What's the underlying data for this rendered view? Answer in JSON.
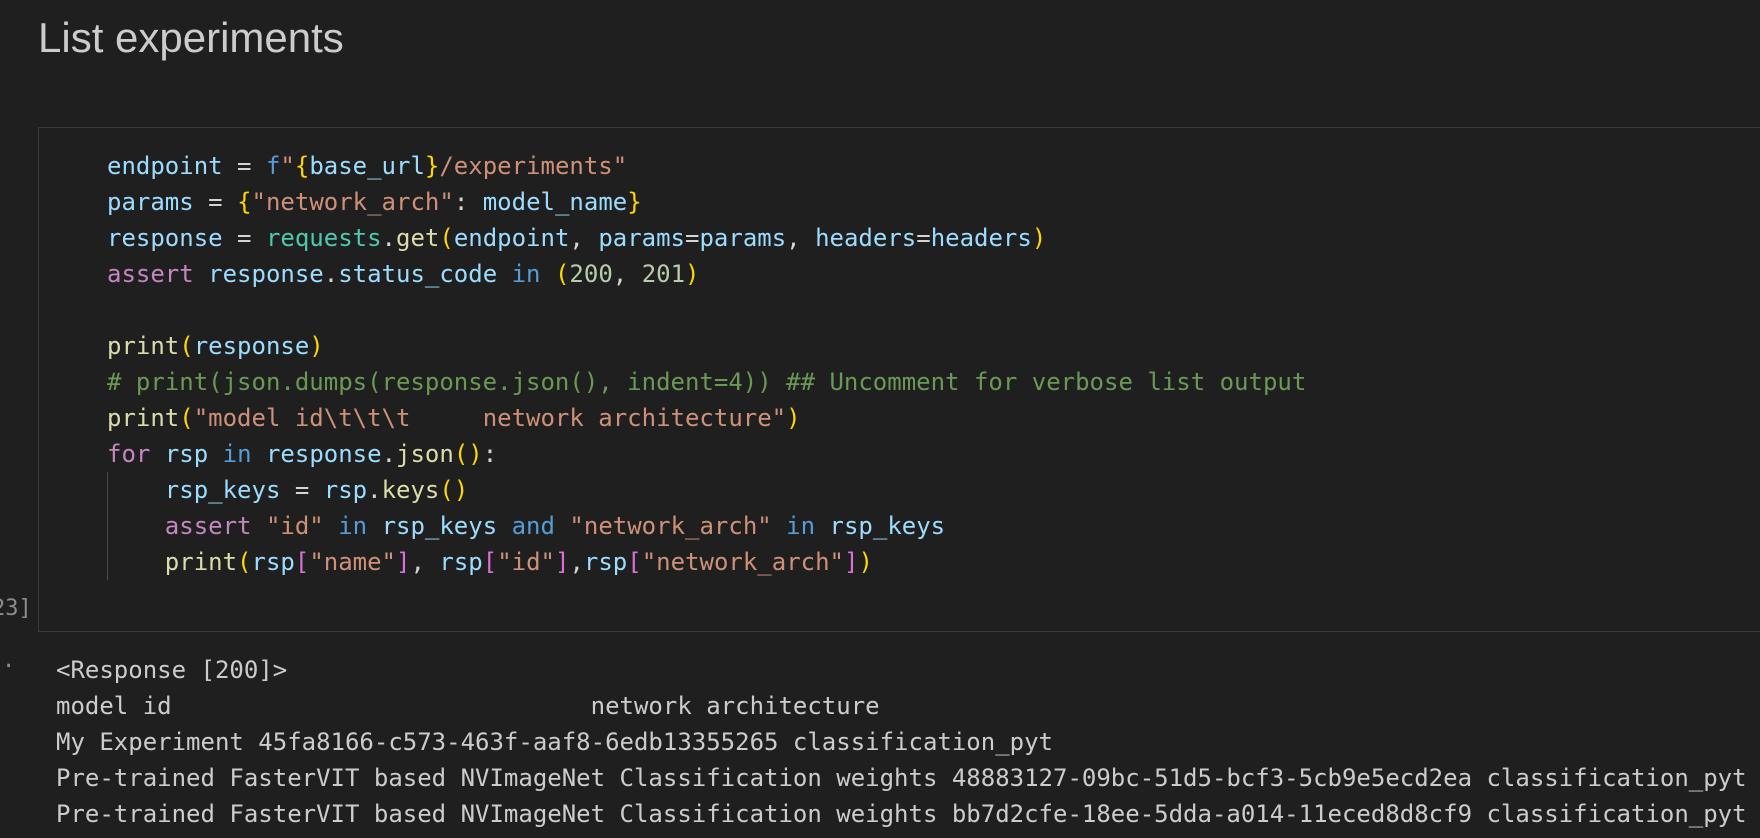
{
  "heading": "List experiments",
  "execution_count": "23]",
  "output_marker": "·",
  "code_tokens": {
    "l1": [
      "endpoint",
      " = ",
      "f",
      "\"",
      "{",
      "base_url",
      "}",
      "/experiments\""
    ],
    "l2": [
      "params",
      " = ",
      "{",
      "\"network_arch\"",
      ": ",
      "model_name",
      "}"
    ],
    "l3": [
      "response",
      " = ",
      "requests",
      ".",
      "get",
      "(",
      "endpoint",
      ", ",
      "params",
      "=",
      "params",
      ", ",
      "headers",
      "=",
      "headers",
      ")"
    ],
    "l4": [
      "assert",
      " ",
      "response",
      ".",
      "status_code",
      " ",
      "in",
      " ",
      "(",
      "200",
      ", ",
      "201",
      ")"
    ],
    "l6": [
      "print",
      "(",
      "response",
      ")"
    ],
    "l7": [
      "# print(json.dumps(response.json(), indent=4)) ## Uncomment for verbose list output"
    ],
    "l8": [
      "print",
      "(",
      "\"model id\\t\\t\\t     network architecture\"",
      ")"
    ],
    "l9": [
      "for",
      " ",
      "rsp",
      " ",
      "in",
      " ",
      "response",
      ".",
      "json",
      "(",
      ")",
      ":"
    ],
    "l10": [
      "    ",
      "rsp_keys",
      " = ",
      "rsp",
      ".",
      "keys",
      "(",
      ")"
    ],
    "l11": [
      "    ",
      "assert",
      " ",
      "\"id\"",
      " ",
      "in",
      " ",
      "rsp_keys",
      " ",
      "and",
      " ",
      "\"network_arch\"",
      " ",
      "in",
      " ",
      "rsp_keys"
    ],
    "l12": [
      "    ",
      "print",
      "(",
      "rsp",
      "[",
      "\"name\"",
      "]",
      ", ",
      "rsp",
      "[",
      "\"id\"",
      "]",
      ",",
      "rsp",
      "[",
      "\"network_arch\"",
      "]",
      ")"
    ]
  },
  "output_lines": [
    "<Response [200]>",
    "model id                             network architecture",
    "My Experiment 45fa8166-c573-463f-aaf8-6edb13355265 classification_pyt",
    "Pre-trained FasterVIT based NVImageNet Classification weights 48883127-09bc-51d5-bcf3-5cb9e5ecd2ea classification_pyt",
    "Pre-trained FasterVIT based NVImageNet Classification weights bb7d2cfe-18ee-5dda-a014-11eced8d8cf9 classification_pyt"
  ]
}
